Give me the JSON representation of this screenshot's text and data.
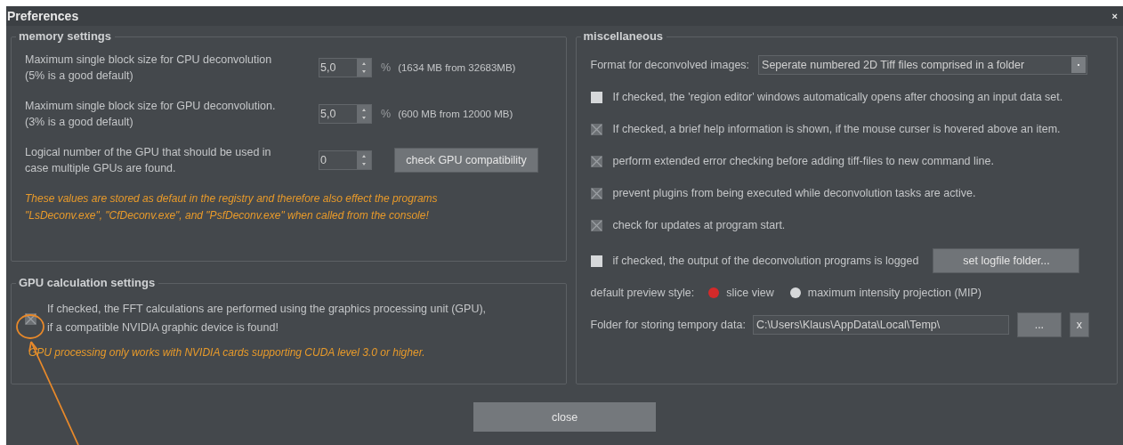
{
  "window": {
    "title": "Preferences",
    "close": "×"
  },
  "memory": {
    "title": "memory settings",
    "rows": [
      {
        "label": "Maximum single block size for CPU deconvolution\n(5% is a good default)",
        "value": "5,0",
        "unit": "%",
        "info": "(1634 MB from 32683MB)"
      },
      {
        "label": "Maximum single block size for GPU deconvolution.\n(3% is a good default)",
        "value": "5,0",
        "unit": "%",
        "info": "(600 MB from 12000 MB)"
      },
      {
        "label": "Logical number of the GPU that should be used in\ncase multiple GPUs are found.",
        "value": "0",
        "button": "check GPU compatibility"
      }
    ],
    "note": "These values are stored as defaut in the registry and therefore also effect the programs\n\"LsDeconv.exe\", \"CfDeconv.exe\", and \"PsfDeconv.exe\" when called from the console!"
  },
  "gpu": {
    "title": "GPU calculation settings",
    "checkbox": {
      "label": "If checked, the FFT calculations are performed using the graphics processing unit (GPU),\nif a compatible NVIDIA graphic device is found!",
      "checked": true
    },
    "note": "GPU processing only works with NVIDIA cards supporting CUDA level 3.0 or higher."
  },
  "misc": {
    "title": "miscellaneous",
    "format_label": "Format for deconvolved images:",
    "format_value": "Seperate numbered 2D Tiff files comprised in a folder",
    "options": [
      {
        "label": "If checked, the 'region editor' windows automatically opens after choosing an input data set.",
        "checked": false
      },
      {
        "label": "If checked, a brief help information is shown, if the mouse curser is hovered above an item.",
        "checked": true
      },
      {
        "label": "perform extended error checking before adding tiff-files to new command line.",
        "checked": true
      },
      {
        "label": "prevent plugins from being executed while deconvolution tasks are active.",
        "checked": true
      },
      {
        "label": "check for updates at program start.",
        "checked": true
      },
      {
        "label": "if checked, the output of the deconvolution programs is logged",
        "checked": false,
        "button": "set logfile folder..."
      }
    ],
    "preview_label": "default preview style:",
    "preview_options": [
      {
        "label": "slice view",
        "selected": true
      },
      {
        "label": "maximum intensity projection (MIP)",
        "selected": false
      }
    ],
    "folder_label": "Folder for storing tempory data:",
    "folder_value": "C:\\Users\\Klaus\\AppData\\Local\\Temp\\",
    "browse": "...",
    "clear": "x"
  },
  "close_button": "close",
  "annotation": {
    "kind": "circle-arrow"
  }
}
